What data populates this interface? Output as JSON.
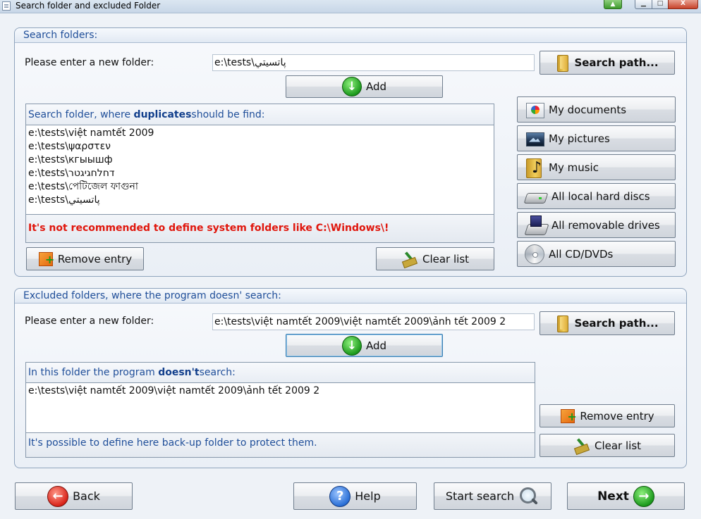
{
  "window": {
    "title": "Search folder and excluded Folder",
    "min_glyph": "▁",
    "max_glyph": "□",
    "close_glyph": "X"
  },
  "search_group": {
    "title": "Search folders:",
    "new_folder_label": "Please enter a new folder:",
    "new_folder_value": "e:\\tests\\پاتسيتي",
    "search_path_label": "Search path...",
    "add_label": "Add",
    "list_header_pre": "Search folder, where ",
    "list_header_bold": "duplicates",
    "list_header_post": "should be find:",
    "items": [
      "e:\\tests\\việt namtết 2009",
      "e:\\tests\\ψαρστεν",
      "e:\\tests\\кгыышф",
      "e:\\tests\\דחלחגיגטר",
      "e:\\tests\\পেটিজেল ফাগুনা",
      "e:\\tests\\پاتسيتي"
    ],
    "warning": "It's not recommended to define system folders like C:\\Windows\\!",
    "remove_entry_label": "Remove entry",
    "clear_list_label": "Clear list",
    "quick_buttons": {
      "my_documents": "My documents",
      "my_pictures": "My pictures",
      "my_music": "My music",
      "all_local_hard_discs": "All local hard discs",
      "all_removable_drives": "All removable drives",
      "all_cd_dvds": "All CD/DVDs"
    }
  },
  "excluded_group": {
    "title": "Excluded folders, where the program doesn' search:",
    "new_folder_label": "Please enter a new folder:",
    "new_folder_value": "e:\\tests\\việt namtết 2009\\việt namtết 2009\\ảnh tết 2009 2",
    "search_path_label": "Search path...",
    "add_label": "Add",
    "list_header_pre": "In this folder the program ",
    "list_header_bold": "doesn't",
    "list_header_post": "search:",
    "items": [
      "e:\\tests\\việt namtết 2009\\việt namtết 2009\\ảnh tết 2009 2"
    ],
    "info": "It's possible to define here back-up folder to protect them.",
    "remove_entry_label": "Remove entry",
    "clear_list_label": "Clear list"
  },
  "footer": {
    "back_label": "Back",
    "help_label": "Help",
    "start_search_label": "Start search",
    "next_label": "Next"
  }
}
